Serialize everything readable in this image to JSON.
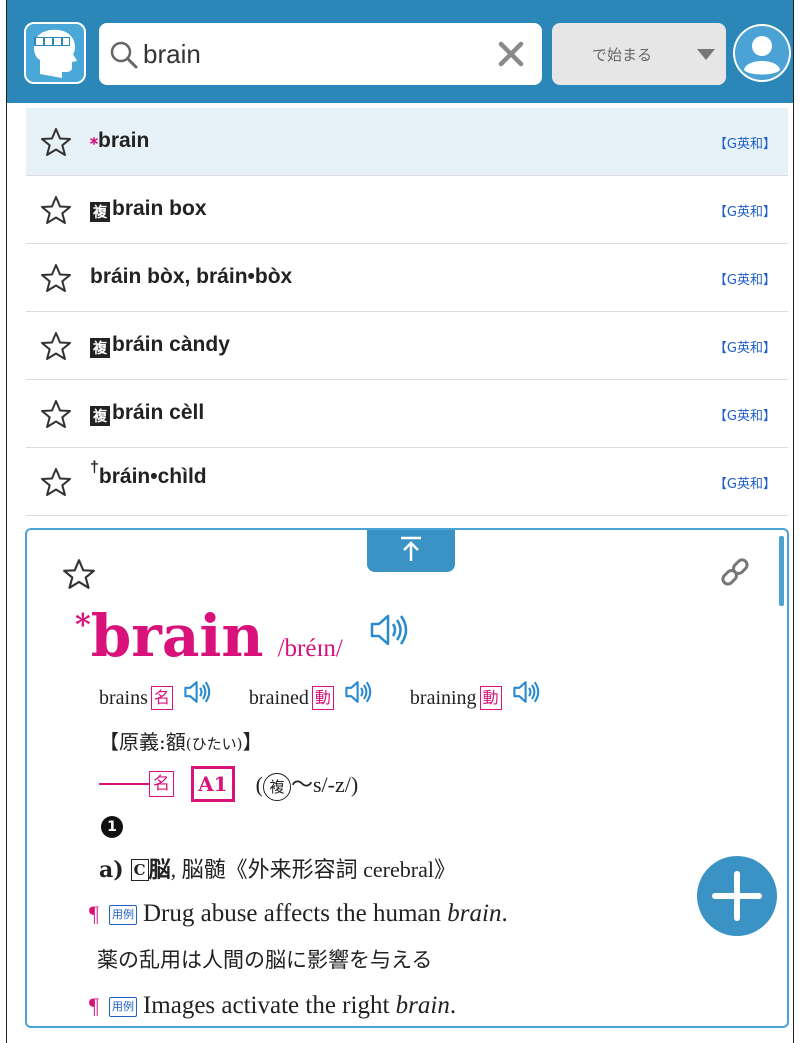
{
  "search": {
    "value": "brain",
    "mode": "で始まる"
  },
  "results": [
    {
      "headword": "brain",
      "prefix": "*",
      "source": "【G英和】",
      "selected": true
    },
    {
      "headword": "brain box",
      "prefix": "box",
      "source": "【G英和】"
    },
    {
      "headword": "bráin bòx, bráin•bòx",
      "prefix": "",
      "source": "【G英和】"
    },
    {
      "headword": "bráin càndy",
      "prefix": "box",
      "source": "【G英和】"
    },
    {
      "headword": "bráin cèll",
      "prefix": "box",
      "source": "【G英和】"
    },
    {
      "headword": "bráin•chìld",
      "prefix": "†",
      "source": "【G英和】"
    }
  ],
  "entry": {
    "headword_mark": "*",
    "headword": "brain",
    "pronunciation": "/bréɪn/",
    "forms": [
      {
        "word": "brains",
        "pos": "名"
      },
      {
        "word": "brained",
        "pos": "動"
      },
      {
        "word": "braining",
        "pos": "動"
      }
    ],
    "origin": "【原義:額",
    "origin_reading": "(ひたい)",
    "origin_close": "】",
    "pos_box": "名",
    "level": "A1",
    "plural_open": "(",
    "plural_mark": "複",
    "plural_rest": "～s/-z/)",
    "sense_number": "1",
    "definition": {
      "label": "a)",
      "countable": "C",
      "text": "脳",
      "rest": ", 脳髄《外来形容詞 cerebral》"
    },
    "examples": [
      {
        "pilcrow": "¶",
        "tag": "用例",
        "text_pre": "Drug abuse affects the human ",
        "text_em": "brain",
        "text_post": ".",
        "translation": "薬の乱用は人間の脳に影響を与える"
      },
      {
        "pilcrow": "¶",
        "tag": "用例",
        "text_pre": "Images activate the right ",
        "text_em": "brain",
        "text_post": ".",
        "translation": ""
      }
    ]
  },
  "colors": {
    "header": "#2a87b8",
    "accent": "#d8127a",
    "link_blue": "#1f5fc7",
    "panel_border": "#4aa3d4",
    "fab": "#3a93c4",
    "selected_row": "#e7f1f8"
  },
  "icons": [
    "app-logo-icon",
    "search-icon",
    "clear-icon",
    "dropdown-caret-icon",
    "user-avatar-icon",
    "star-icon",
    "scroll-to-top-icon",
    "link-icon",
    "speaker-icon",
    "plus-icon"
  ]
}
